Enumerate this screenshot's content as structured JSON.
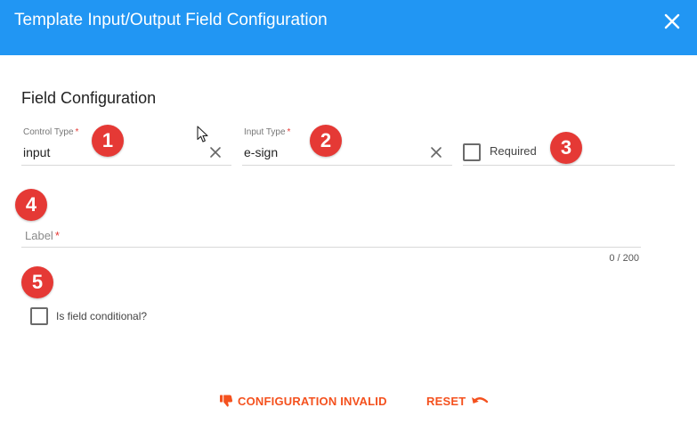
{
  "dialog": {
    "title": "Template Input/Output Field Configuration",
    "header_color": "#2196f3",
    "close_icon": "close-icon"
  },
  "section": {
    "title": "Field Configuration"
  },
  "fields": {
    "control_type": {
      "label": "Control Type",
      "required_mark": "*",
      "value": "input"
    },
    "input_type": {
      "label": "Input Type",
      "required_mark": "*",
      "value": "e-sign"
    },
    "required": {
      "label": "Required",
      "checked": false
    },
    "label": {
      "placeholder": "Label",
      "required_mark": "*",
      "value": "",
      "counter": "0 / 200"
    },
    "conditional": {
      "label": "Is field conditional?",
      "checked": false
    }
  },
  "badges": [
    "1",
    "2",
    "3",
    "4",
    "5"
  ],
  "badge_color": "#e53935",
  "footer": {
    "status_label": "CONFIGURATION INVALID",
    "status_icon": "thumbs-down-icon",
    "reset_label": "RESET",
    "reset_icon": "undo-icon",
    "accent_color": "#f4511e"
  }
}
